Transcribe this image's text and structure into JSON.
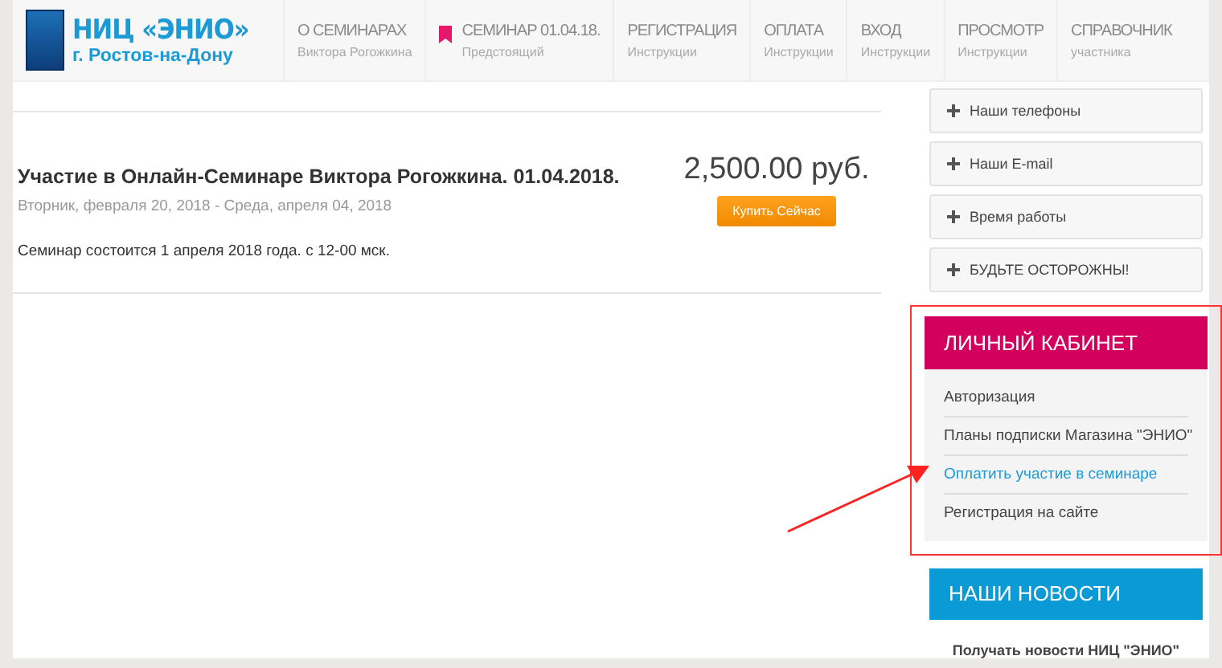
{
  "logo": {
    "title": "НИЦ «ЭНИО»",
    "subtitle": "г. Ростов-на-Дону"
  },
  "nav": [
    {
      "title": "О СЕМИНАРАХ",
      "subtitle": "Виктора Рогожкина",
      "flagged": false
    },
    {
      "title": "СЕМИНАР 01.04.18.",
      "subtitle": "Предстоящий",
      "flagged": true
    },
    {
      "title": "РЕГИСТРАЦИЯ",
      "subtitle": "Инструкции",
      "flagged": false
    },
    {
      "title": "ОПЛАТА",
      "subtitle": "Инструкции",
      "flagged": false
    },
    {
      "title": "ВХОД",
      "subtitle": "Инструкции",
      "flagged": false
    },
    {
      "title": "ПРОСМОТР",
      "subtitle": "Инструкции",
      "flagged": false
    },
    {
      "title": "СПРАВОЧНИК",
      "subtitle": "участника",
      "flagged": false
    }
  ],
  "event": {
    "title": "Участие в Онлайн-Семинаре Виктора Рогожкина. 01.04.2018.",
    "dates": "Вторник, февраля 20, 2018 - Среда, апреля 04, 2018",
    "description": "Семинар состоится 1 апреля 2018 года. с 12-00 мск.",
    "price": "2,500.00 руб.",
    "buy_button": "Купить Сейчас"
  },
  "accordion": [
    {
      "label": "Наши телефоны",
      "expanded": false
    },
    {
      "label": "Наши E-mail",
      "expanded": false
    },
    {
      "label": "Время работы",
      "expanded": false
    },
    {
      "label": "БУДЬТЕ ОСТОРОЖНЫ!",
      "expanded": false
    }
  ],
  "cabinet": {
    "title": "ЛИЧНЫЙ КАБИНЕТ",
    "links": [
      {
        "label": "Авторизация",
        "selected": false
      },
      {
        "label": "Планы подписки Магазина \"ЭНИО\"",
        "selected": false
      },
      {
        "label": "Оплатить участие в семинаре",
        "selected": true
      },
      {
        "label": "Регистрация на сайте",
        "selected": false
      }
    ]
  },
  "news": {
    "title": "НАШИ НОВОСТИ",
    "subscribe": "Получать новости НИЦ \"ЭНИО\""
  }
}
